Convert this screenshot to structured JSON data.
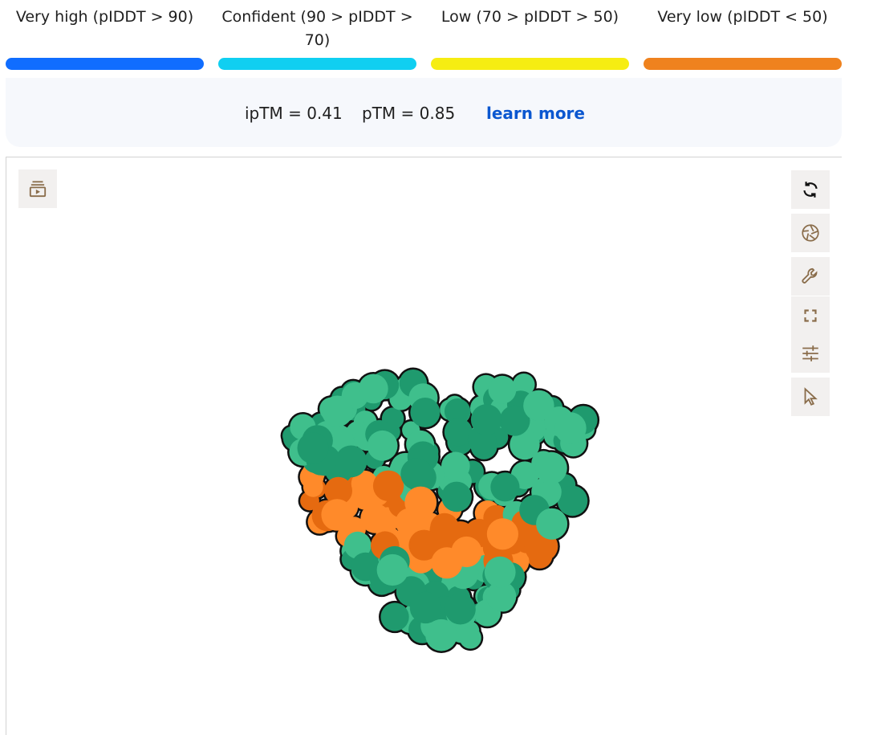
{
  "legend": {
    "items": [
      {
        "label": "Very high (pIDDT > 90)",
        "color": "#106dff"
      },
      {
        "label": "Confident (90 > pIDDT > 70)",
        "color": "#10cff1"
      },
      {
        "label": "Low (70 > pIDDT > 50)",
        "color": "#f6ed12"
      },
      {
        "label": "Very low (pIDDT < 50)",
        "color": "#ef821e"
      }
    ]
  },
  "metrics": {
    "iptm": "ipTM = 0.41",
    "ptm": "pTM = 0.85",
    "learn_more": "learn more"
  },
  "viewer": {
    "toolbar": [
      {
        "icon": "refresh-icon"
      },
      {
        "icon": "camera-shutter-icon"
      },
      {
        "icon": "wrench-icon"
      },
      {
        "icon": "fullscreen-icon"
      },
      {
        "icon": "sliders-icon"
      },
      {
        "icon": "cursor-icon"
      }
    ],
    "left_tool": {
      "icon": "animation-play-icon"
    },
    "colors": {
      "icon": "#8a6d4b",
      "protein_a": "#3fbf8c",
      "protein_b": "#1f9a6e",
      "ligand_a": "#ff8a2a",
      "ligand_b": "#e56a10",
      "outline": "#111111"
    }
  }
}
